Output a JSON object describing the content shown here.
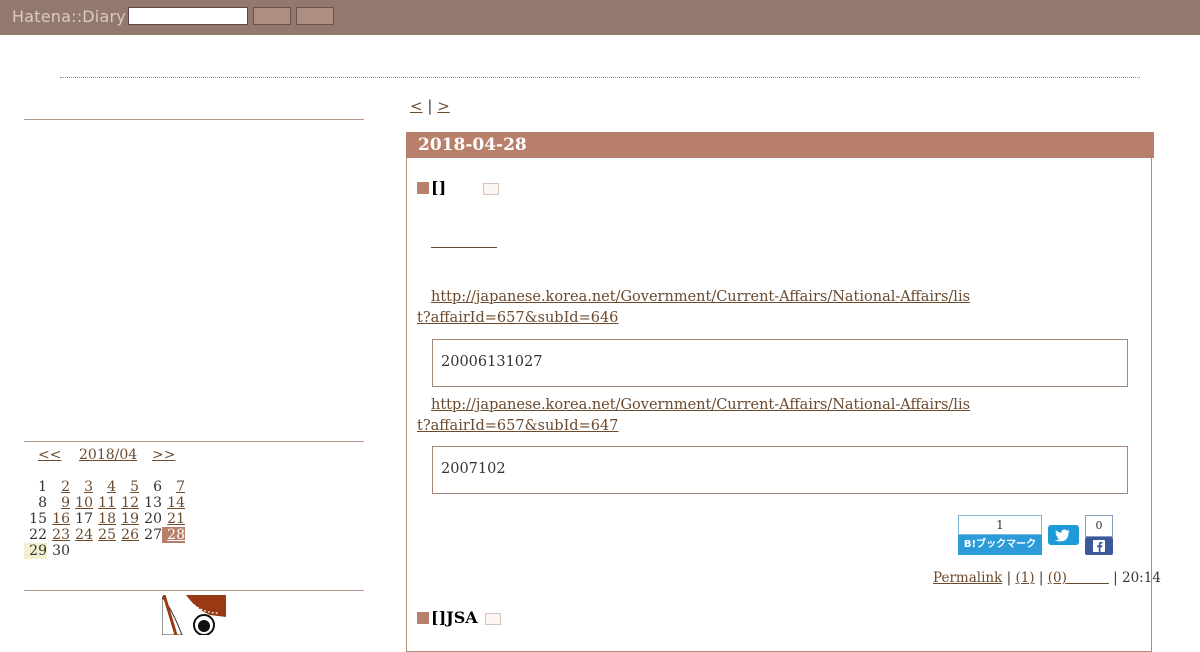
{
  "header": {
    "logo": "Hatena::Diary",
    "search_value": "",
    "colors": {
      "bar": "#93786d",
      "accent": "#b8806a"
    }
  },
  "sidebar": {
    "calendar": {
      "prev": "<<",
      "month": "2018/04",
      "next": ">>",
      "weeks": [
        [
          {
            "d": "1",
            "link": false
          },
          {
            "d": "2",
            "link": true
          },
          {
            "d": "3",
            "link": true
          },
          {
            "d": "4",
            "link": true
          },
          {
            "d": "5",
            "link": true
          },
          {
            "d": "6",
            "link": false
          },
          {
            "d": "7",
            "link": true
          }
        ],
        [
          {
            "d": "8",
            "link": false
          },
          {
            "d": "9",
            "link": true
          },
          {
            "d": "10",
            "link": true
          },
          {
            "d": "11",
            "link": true
          },
          {
            "d": "12",
            "link": true
          },
          {
            "d": "13",
            "link": false
          },
          {
            "d": "14",
            "link": true
          }
        ],
        [
          {
            "d": "15",
            "link": false
          },
          {
            "d": "16",
            "link": true
          },
          {
            "d": "17",
            "link": false
          },
          {
            "d": "18",
            "link": true
          },
          {
            "d": "19",
            "link": true
          },
          {
            "d": "20",
            "link": false
          },
          {
            "d": "21",
            "link": true
          }
        ],
        [
          {
            "d": "22",
            "link": false
          },
          {
            "d": "23",
            "link": true
          },
          {
            "d": "24",
            "link": true
          },
          {
            "d": "25",
            "link": true
          },
          {
            "d": "26",
            "link": true
          },
          {
            "d": "27",
            "link": false
          },
          {
            "d": "28",
            "link": true,
            "today": true
          }
        ],
        [
          {
            "d": "29",
            "link": false,
            "highlight": true
          },
          {
            "d": "30",
            "link": false
          }
        ]
      ]
    }
  },
  "main": {
    "pager": {
      "prev": "<",
      "sep": "|",
      "next": ">"
    },
    "day_title": "2018-04-28",
    "section1": {
      "title": "[]",
      "url1": "http://japanese.korea.net/Government/Current-Affairs/National-Affairs/list?affairId=657&subId=646",
      "quote1": "20006131027",
      "url2": "http://japanese.korea.net/Government/Current-Affairs/National-Affairs/list?affairId=657&subId=647",
      "quote2": "2007102"
    },
    "share": {
      "hatena_count": "1",
      "hatena_label": "B!ブックマーク",
      "fb_count": "0"
    },
    "footer": {
      "permalink": "Permalink",
      "comments": "(1)",
      "trackbacks": "(0)",
      "sep": "|",
      "time": "20:14"
    },
    "section2": {
      "title": "[]JSA"
    }
  }
}
